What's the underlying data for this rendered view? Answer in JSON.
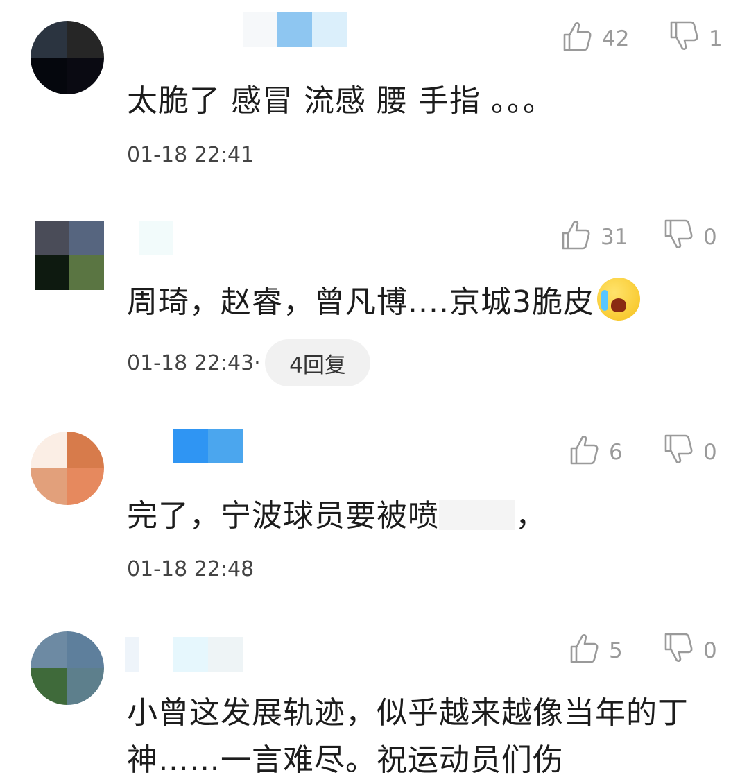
{
  "comments": [
    {
      "likes": "42",
      "dislikes": "1",
      "text": "太脆了 感冒 流感 腰 手指 。。。",
      "time": "01-18 22:41"
    },
    {
      "likes": "31",
      "dislikes": "0",
      "text": "周琦，赵睿，曾凡博....京城3脆皮",
      "emoji": "crying-face-emoji",
      "time": "01-18 22:43·",
      "reply_label": "4回复"
    },
    {
      "likes": "6",
      "dislikes": "0",
      "text": "完了，宁波球员要被喷",
      "text_tail": "，",
      "time": "01-18 22:48"
    },
    {
      "likes": "5",
      "dislikes": "0",
      "text": "小曾这发展轨迹，似乎越来越像当年的丁神……一言难尽。祝运动员们伤"
    }
  ],
  "icons": {
    "like": "thumb-up-icon",
    "dislike": "thumb-down-icon"
  },
  "colors": {
    "stat_gray": "#9a9a9a",
    "pill_bg": "#f1f1f1"
  }
}
